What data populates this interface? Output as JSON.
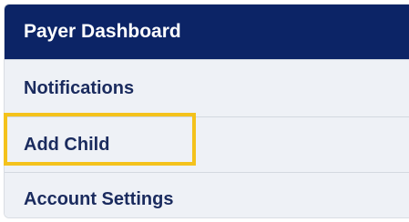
{
  "menu": {
    "header": "Payer Dashboard",
    "items": [
      {
        "label": "Notifications"
      },
      {
        "label": "Add Child"
      },
      {
        "label": "Account Settings"
      }
    ]
  },
  "colors": {
    "header_bg": "#0c2466",
    "item_bg": "#eef1f6",
    "highlight": "#f4c21c"
  }
}
